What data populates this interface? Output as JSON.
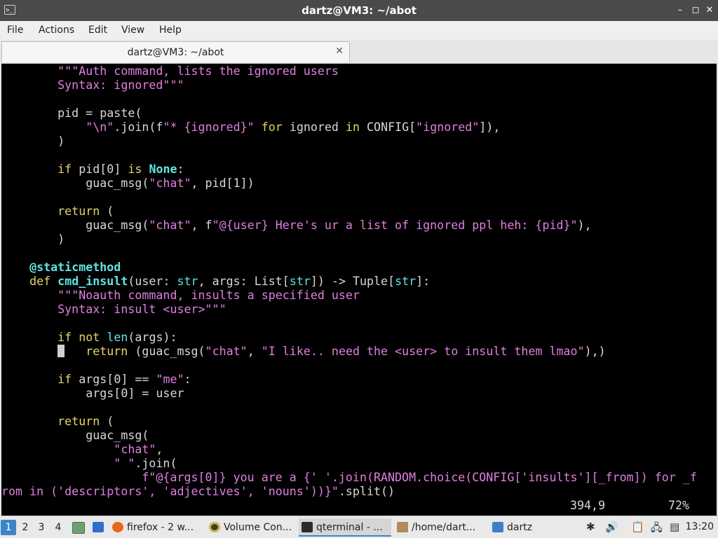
{
  "window": {
    "title": "dartz@VM3: ~/abot",
    "terminal_icon_text": ">_",
    "minimize_glyph": "–",
    "maximize_glyph": "◻",
    "close_glyph": "✕"
  },
  "menu": [
    "File",
    "Actions",
    "Edit",
    "View",
    "Help"
  ],
  "tab": {
    "label": "dartz@VM3: ~/abot",
    "close_glyph": "✕"
  },
  "terminal": {
    "line_position": "394,9",
    "scroll_percent": "72%",
    "code_lines": [
      "        \"\"\"Auth command, lists the ignored users",
      "        Syntax: ignored\"\"\"",
      "",
      "        pid = paste(",
      "            \"\\n\".join(f\"* {ignored}\" for ignored in CONFIG[\"ignored\"]),",
      "        )",
      "",
      "        if pid[0] is None:",
      "            guac_msg(\"chat\", pid[1])",
      "",
      "        return (",
      "            guac_msg(\"chat\", f\"@{user} Here's ur a list of ignored ppl heh: {pid}\"),",
      "        )",
      "",
      "    @staticmethod",
      "    def cmd_insult(user: str, args: List[str]) -> Tuple[str]:",
      "        \"\"\"Noauth command, insults a specified user",
      "        Syntax: insult <user>\"\"\"",
      "",
      "        if not len(args):",
      "            return (guac_msg(\"chat\", \"I like.. need the <user> to insult them lmao\"),)",
      "",
      "        if args[0] == \"me\":",
      "            args[0] = user",
      "",
      "        return (",
      "            guac_msg(",
      "                \"chat\",",
      "                \" \".join(",
      "                    f\"@{args[0]} you are a {' '.join(RANDOM.choice(CONFIG['insults'][_from]) for _f",
      "rom in ('descriptors', 'adjectives', 'nouns'))}\".split()"
    ]
  },
  "taskbar": {
    "workspaces": [
      "1",
      "2",
      "3",
      "4"
    ],
    "tasks": [
      {
        "label": "firefox - 2 w...",
        "icon": "firefox-icon",
        "color": "#e8671f"
      },
      {
        "label": "Volume Con...",
        "icon": "volume-control-icon",
        "color": "#3a3a3a"
      },
      {
        "label": "qterminal - ...",
        "icon": "terminal-icon",
        "color": "#2b2b2b"
      },
      {
        "label": "/home/dart...",
        "icon": "archive-icon",
        "color": "#b08a5a"
      },
      {
        "label": "dartz",
        "icon": "folder-icon",
        "color": "#3d7ec8"
      }
    ],
    "clock": "13:20"
  },
  "colors": {
    "string": "#e07fe0",
    "keyword": "#e8d26a",
    "type": "#5fe4e4",
    "accent": "#3d86c6"
  }
}
